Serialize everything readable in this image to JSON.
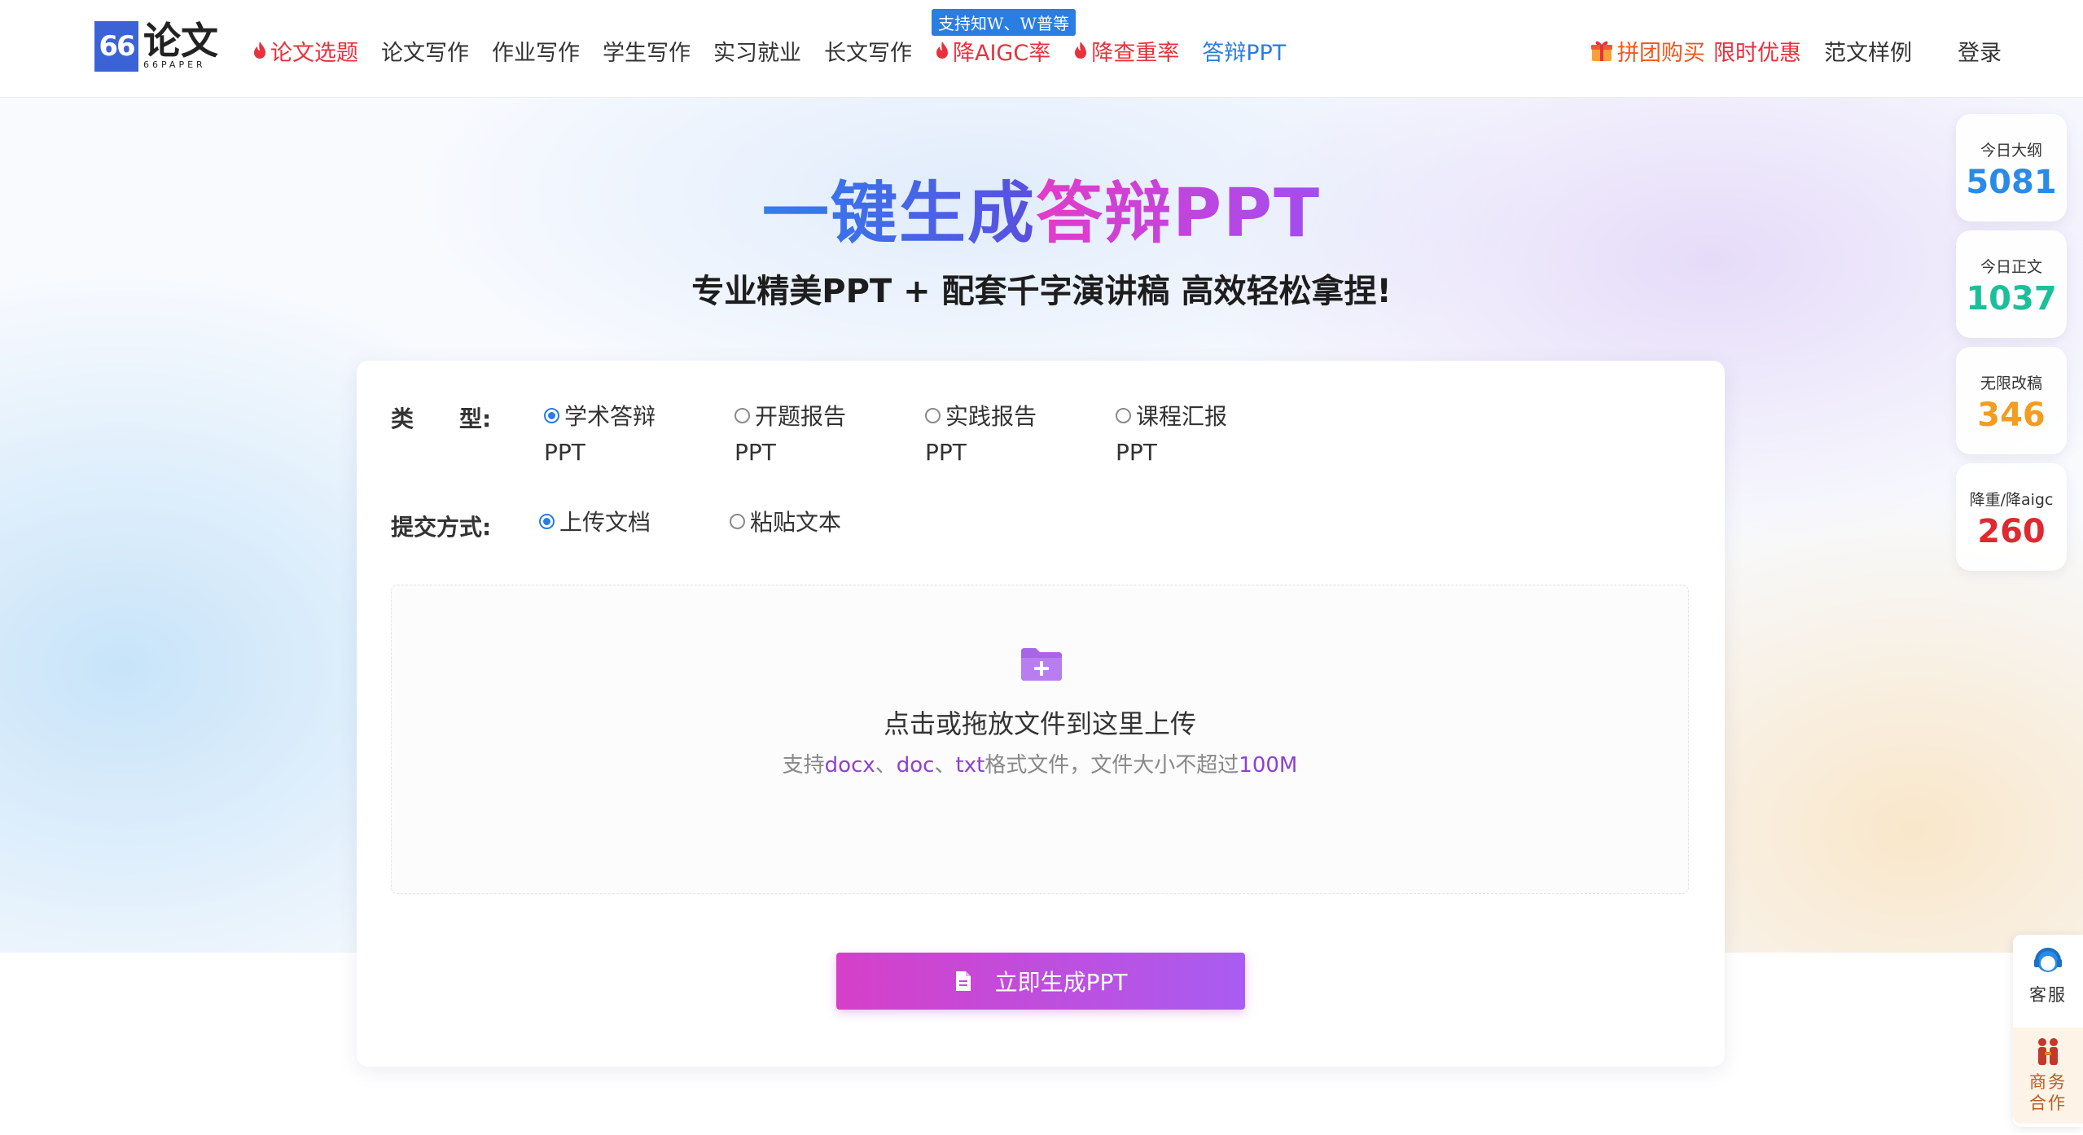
{
  "header": {
    "logo": {
      "mark": "66",
      "name": "论文",
      "sub": "66PAPER"
    },
    "nav": [
      {
        "label": "论文选题",
        "hot": true
      },
      {
        "label": "论文写作"
      },
      {
        "label": "作业写作"
      },
      {
        "label": "学生写作"
      },
      {
        "label": "实习就业"
      },
      {
        "label": "长文写作"
      },
      {
        "label": "降AIGC率",
        "hot": true,
        "badge": "支持知W、W普等"
      },
      {
        "label": "降查重率",
        "hot": true
      },
      {
        "label": "答辩PPT",
        "active": true
      }
    ],
    "promo_main": "拼团购买",
    "promo_sub": "限时优惠",
    "samples": "范文样例",
    "login": "登录"
  },
  "hero": {
    "title_part1": "一键生成",
    "title_part2": "答辩PPT",
    "subtitle": "专业精美PPT + 配套千字演讲稿 高效轻松拿捏!"
  },
  "form": {
    "type_label": "类　　型:",
    "types": [
      {
        "label": "学术答辩",
        "label2": "PPT",
        "checked": true
      },
      {
        "label": "开题报告",
        "label2": "PPT",
        "checked": false
      },
      {
        "label": "实践报告",
        "label2": "PPT",
        "checked": false
      },
      {
        "label": "课程汇报",
        "label2": "PPT",
        "checked": false
      }
    ],
    "submit_label": "提交方式:",
    "submit_modes": [
      {
        "label": "上传文档",
        "checked": true
      },
      {
        "label": "粘贴文本",
        "checked": false
      }
    ],
    "upload": {
      "title": "点击或拖放文件到这里上传",
      "hint_prefix": "支持",
      "fmt1": "docx",
      "sep1": "、",
      "fmt2": "doc",
      "sep2": "、",
      "fmt3": "txt",
      "hint_mid": "格式文件，文件大小不超过",
      "size": "100M"
    },
    "generate_button": "立即生成PPT"
  },
  "stats": [
    {
      "label": "今日大纲",
      "value": "5081",
      "color": "#2a8be6"
    },
    {
      "label": "今日正文",
      "value": "1037",
      "color": "#1bbf9a"
    },
    {
      "label": "无限改稿",
      "value": "346",
      "color": "#f39c1f"
    },
    {
      "label": "降重/降aigc",
      "value": "260",
      "color": "#e0282f"
    }
  ],
  "service": {
    "support": "客服",
    "business_line1": "商务",
    "business_line2": "合作"
  },
  "colors": {
    "primary": "#2a7de1",
    "hot": "#e8313d",
    "brand_gradient_start": "#d63fc8",
    "brand_gradient_end": "#a95cf2"
  }
}
